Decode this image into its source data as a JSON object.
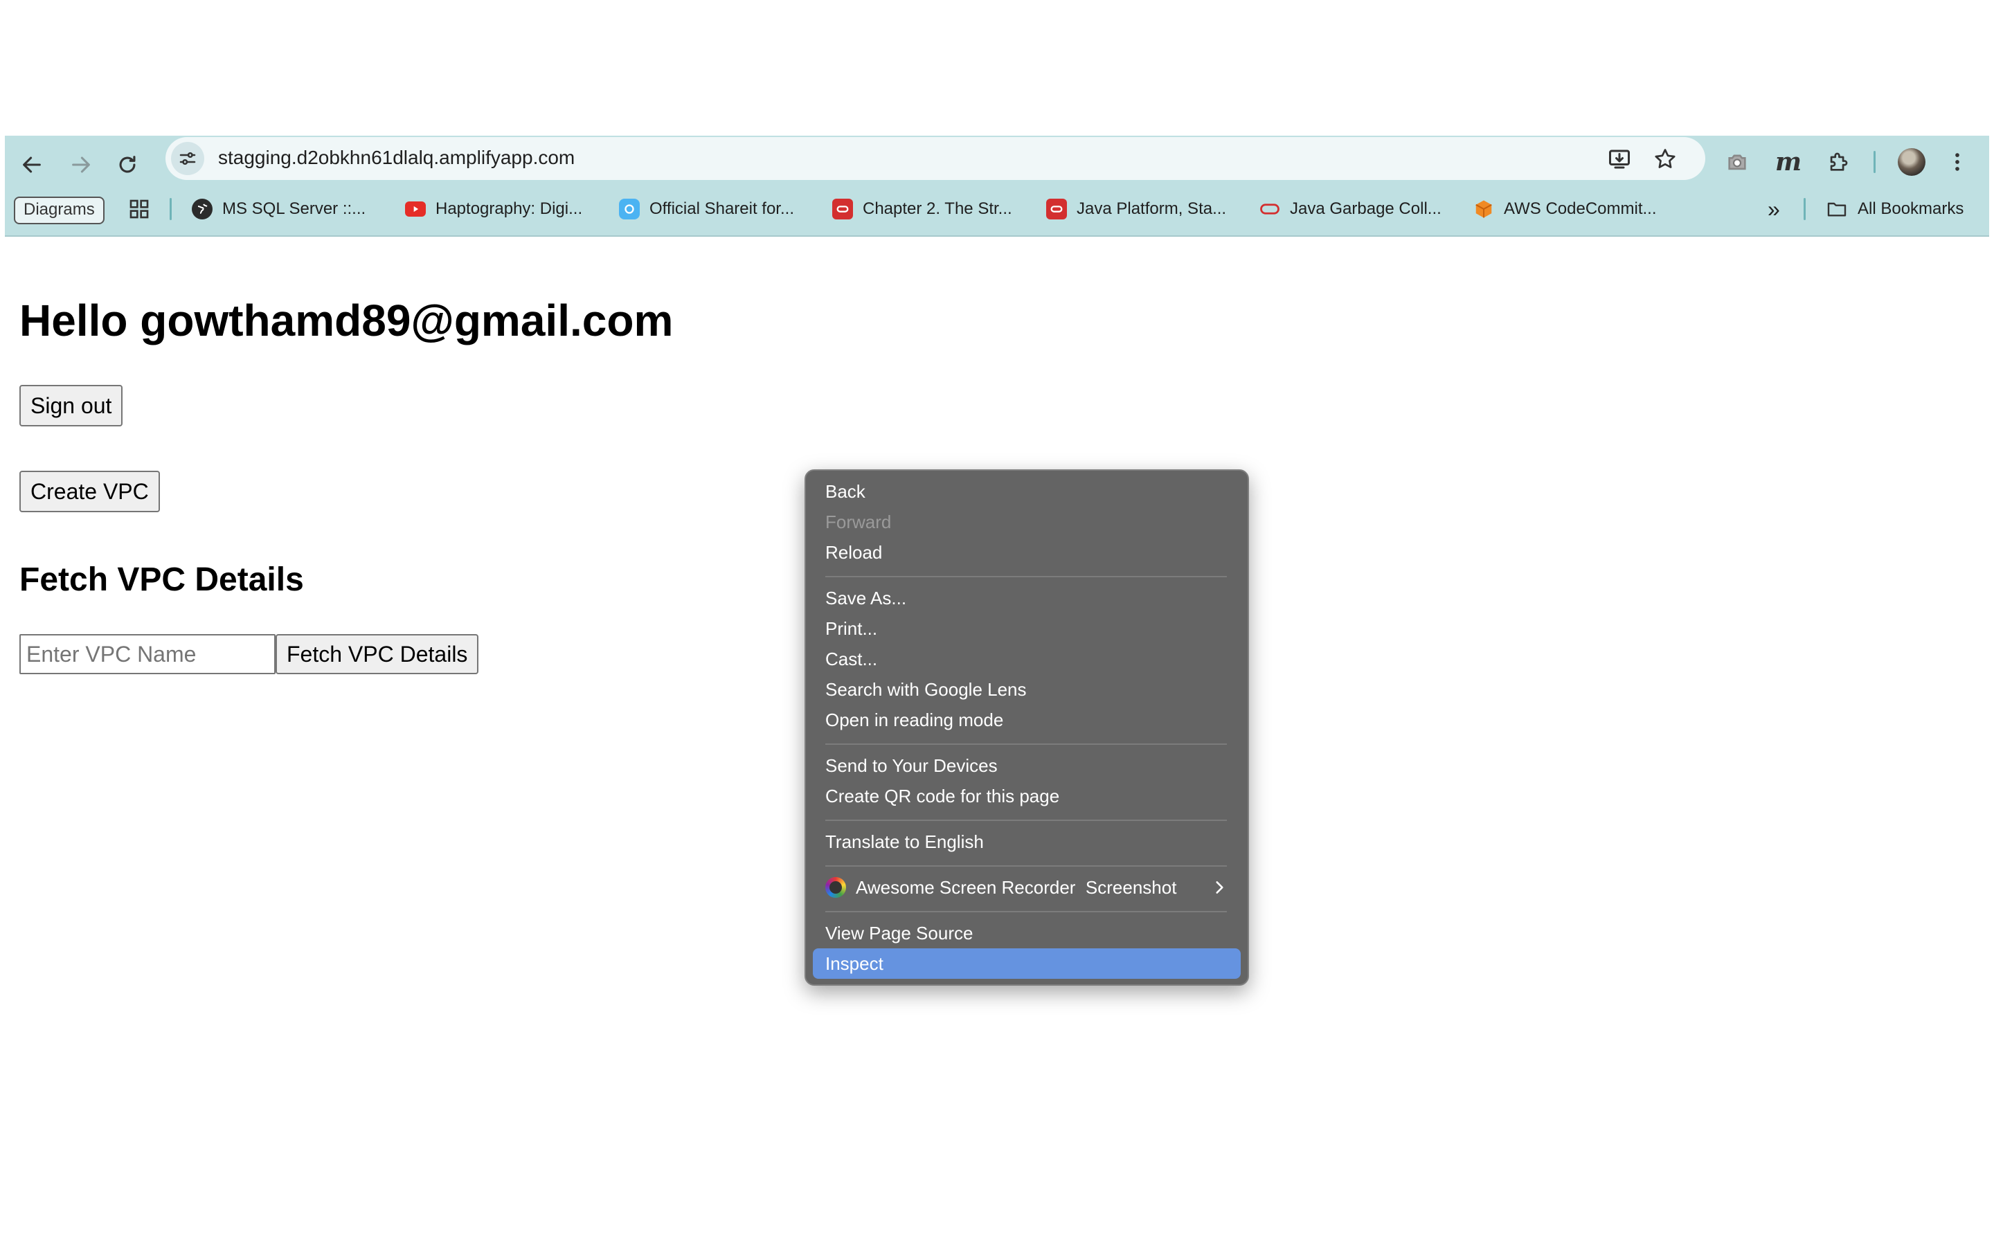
{
  "browser": {
    "url": "stagging.d2obkhn61dlalq.amplifyapp.com",
    "icons": [
      "back-icon",
      "forward-icon",
      "reload-icon",
      "site-info-icon",
      "install-icon",
      "star-icon",
      "camera-icon",
      "m-extension-icon",
      "extensions-puzzle-icon",
      "profile-avatar",
      "more-menu-icon"
    ],
    "bookmarks": {
      "diagrams": "Diagrams",
      "items": [
        {
          "label": "MS SQL Server ::...",
          "icon": "globe-icon"
        },
        {
          "label": "Haptography: Digi...",
          "icon": "youtube-icon"
        },
        {
          "label": "Official Shareit for...",
          "icon": "shareit-icon"
        },
        {
          "label": "Chapter 2. The Str...",
          "icon": "oracle-icon"
        },
        {
          "label": "Java Platform, Sta...",
          "icon": "oracle-icon"
        },
        {
          "label": "Java Garbage Coll...",
          "icon": "oracle-outline-icon"
        },
        {
          "label": "AWS CodeCommit...",
          "icon": "aws-cube-icon"
        }
      ],
      "overflow": "»",
      "all": "All Bookmarks"
    }
  },
  "page": {
    "greeting": "Hello gowthamd89@gmail.com",
    "sign_out": "Sign out",
    "create_vpc": "Create VPC",
    "section_title": "Fetch VPC Details",
    "input_placeholder": "Enter VPC Name",
    "fetch_button": "Fetch VPC Details"
  },
  "context_menu": {
    "back": "Back",
    "forward": "Forward",
    "reload": "Reload",
    "save_as": "Save As...",
    "print": "Print...",
    "cast": "Cast...",
    "lens": "Search with Google Lens",
    "reading_mode": "Open in reading mode",
    "send_devices": "Send to Your Devices",
    "qr": "Create QR code for this page",
    "translate": "Translate to English",
    "recorder": "Awesome Screen Recorder  Screenshot",
    "view_source": "View Page Source",
    "inspect": "Inspect"
  },
  "colors": {
    "toolbar_bg": "#bfe0e2",
    "menu_bg": "#646464",
    "menu_highlight": "#6593e0"
  }
}
